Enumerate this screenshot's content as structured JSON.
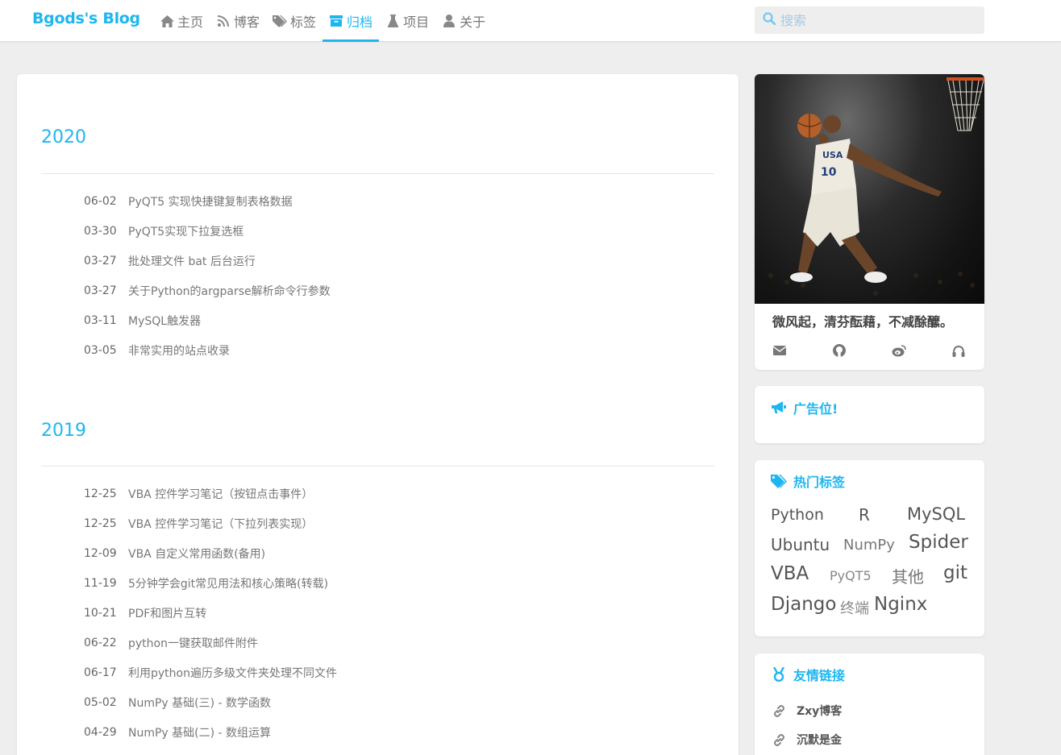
{
  "brand": "Bgods's Blog",
  "nav": [
    {
      "label": "主页",
      "icon": "home-icon"
    },
    {
      "label": "博客",
      "icon": "rss-icon"
    },
    {
      "label": "标签",
      "icon": "tags-icon"
    },
    {
      "label": "归档",
      "icon": "archive-icon",
      "active": true
    },
    {
      "label": "项目",
      "icon": "flask-icon"
    },
    {
      "label": "关于",
      "icon": "user-icon"
    }
  ],
  "search": {
    "placeholder": "搜索",
    "icon": "search-icon"
  },
  "archive": [
    {
      "year": "2020",
      "posts": [
        {
          "date": "06-02",
          "title": "PyQT5 实现快捷键复制表格数据"
        },
        {
          "date": "03-30",
          "title": "PyQT5实现下拉复选框"
        },
        {
          "date": "03-27",
          "title": "批处理文件 bat 后台运行"
        },
        {
          "date": "03-27",
          "title": "关于Python的argparse解析命令行参数"
        },
        {
          "date": "03-11",
          "title": "MySQL触发器"
        },
        {
          "date": "03-05",
          "title": "非常实用的站点收录"
        }
      ]
    },
    {
      "year": "2019",
      "posts": [
        {
          "date": "12-25",
          "title": "VBA 控件学习笔记（按钮点击事件）"
        },
        {
          "date": "12-25",
          "title": "VBA 控件学习笔记（下拉列表实现）"
        },
        {
          "date": "12-09",
          "title": "VBA 自定义常用函数(备用)"
        },
        {
          "date": "11-19",
          "title": "5分钟学会git常见用法和核心策略(转载)"
        },
        {
          "date": "10-21",
          "title": "PDF和图片互转"
        },
        {
          "date": "06-22",
          "title": "python一键获取邮件附件"
        },
        {
          "date": "06-17",
          "title": "利用python遍历多级文件夹处理不同文件"
        },
        {
          "date": "05-02",
          "title": "NumPy 基础(三) - 数学函数"
        },
        {
          "date": "04-29",
          "title": "NumPy 基础(二) - 数组运算"
        }
      ]
    }
  ],
  "profile": {
    "motto": "微风起，清芬酝藉，不减酴醿。",
    "social_icons": [
      "envelope-icon",
      "github-icon",
      "weibo-icon",
      "headphones-icon"
    ]
  },
  "ad": {
    "title": "广告位!",
    "icon": "bullhorn-icon"
  },
  "hot_tags": {
    "title": "热门标签",
    "icon": "tags-icon",
    "tags": [
      "Python",
      "R",
      "MySQL",
      "Ubuntu",
      "NumPy",
      "Spider",
      "VBA",
      "PyQT5",
      "其他",
      "git",
      "Django",
      "终端",
      "Nginx"
    ]
  },
  "friends": {
    "title": "友情链接",
    "icon": "medal-icon",
    "links": [
      {
        "label": "Zxy博客",
        "icon": "link-icon"
      },
      {
        "label": "沉默是金",
        "icon": "link-icon"
      }
    ]
  },
  "colors": {
    "accent": "#1fb6f0",
    "background": "#eeeeee"
  }
}
